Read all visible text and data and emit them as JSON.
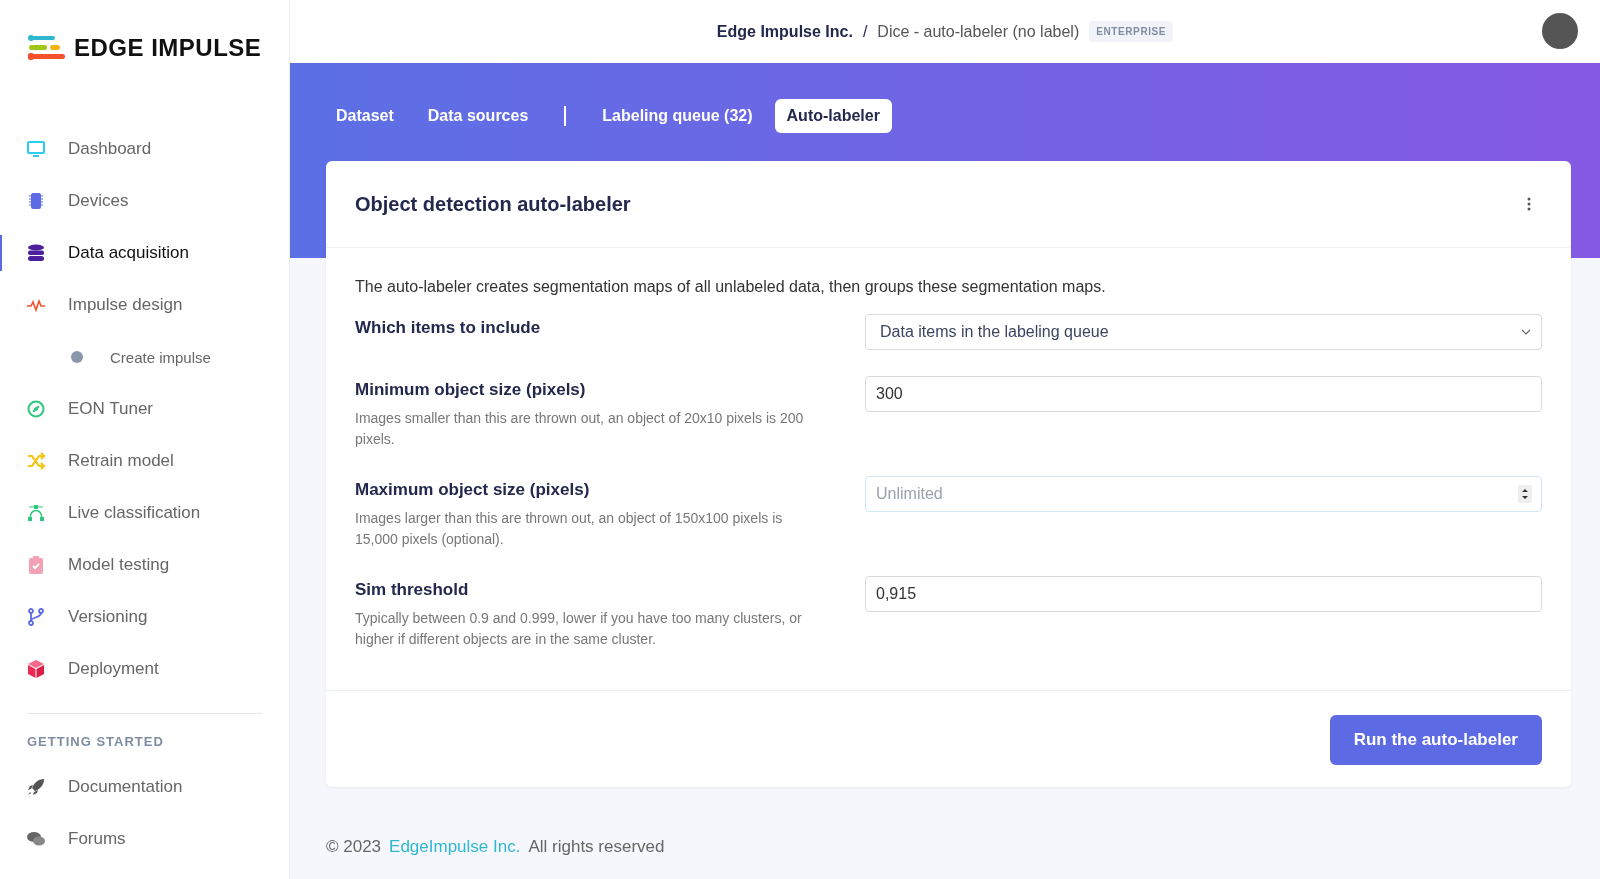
{
  "sidebar": {
    "logo": "EDGE IMPULSE",
    "items": [
      {
        "label": "Dashboard",
        "selected": false
      },
      {
        "label": "Devices",
        "selected": false
      },
      {
        "label": "Data acquisition",
        "selected": true
      },
      {
        "label": "Impulse design",
        "selected": false,
        "children": [
          {
            "label": "Create impulse",
            "selected": false
          }
        ]
      },
      {
        "label": "EON Tuner",
        "selected": false
      },
      {
        "label": "Retrain model",
        "selected": false
      },
      {
        "label": "Live classification",
        "selected": false
      },
      {
        "label": "Model testing",
        "selected": false
      },
      {
        "label": "Versioning",
        "selected": false
      },
      {
        "label": "Deployment",
        "selected": false
      }
    ],
    "section_title": "GETTING STARTED",
    "getting_started": [
      {
        "label": "Documentation"
      },
      {
        "label": "Forums"
      }
    ]
  },
  "header": {
    "organization": "Edge Impulse Inc.",
    "separator": "/",
    "project": "Dice - auto-labeler (no label)",
    "badge": "ENTERPRISE"
  },
  "tabs": [
    {
      "label": "Dataset",
      "selected": false
    },
    {
      "label": "Data sources",
      "selected": false
    },
    {
      "label": "Labeling queue (32)",
      "selected": false
    },
    {
      "label": "Auto-labeler",
      "selected": true
    }
  ],
  "card": {
    "title": "Object detection auto-labeler",
    "intro": "The auto-labeler creates segmentation maps of all unlabeled data, then groups these segmentation maps.",
    "fields": [
      {
        "kind": "select",
        "label": "Which items to include",
        "value": "Data items in the labeling queue"
      },
      {
        "kind": "text",
        "label": "Minimum object size (pixels)",
        "help": "Images smaller than this are thrown out, an object of 20x10 pixels is 200 pixels.",
        "value": "300"
      },
      {
        "kind": "number",
        "label": "Maximum object size (pixels)",
        "help": "Images larger than this are thrown out, an object of 150x100 pixels is 15,000 pixels (optional).",
        "placeholder": "Unlimited"
      },
      {
        "kind": "text",
        "label": "Sim threshold",
        "help": "Typically between 0.9 and 0.999, lower if you have too many clusters, or higher if different objects are in the same cluster.",
        "value": "0,915"
      }
    ],
    "button": "Run the auto-labeler"
  },
  "footer": {
    "copyright": "© 2023",
    "link": "EdgeImpulse Inc.",
    "rights": "All rights reserved"
  }
}
